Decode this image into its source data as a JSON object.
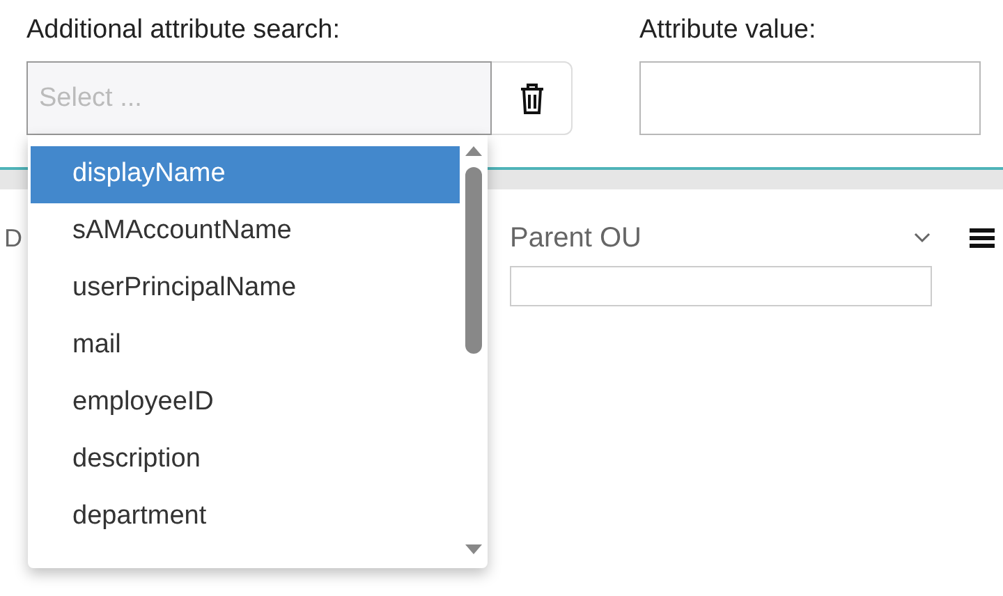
{
  "search_label": "Additional attribute search:",
  "search_field": {
    "placeholder": "Select ..."
  },
  "value_label": "Attribute value:",
  "dropdown": {
    "items": [
      {
        "label": "displayName",
        "selected": true
      },
      {
        "label": "sAMAccountName",
        "selected": false
      },
      {
        "label": "userPrincipalName",
        "selected": false
      },
      {
        "label": "mail",
        "selected": false
      },
      {
        "label": "employeeID",
        "selected": false
      },
      {
        "label": "description",
        "selected": false
      },
      {
        "label": "department",
        "selected": false
      }
    ]
  },
  "grid": {
    "columns": [
      {
        "header": "D"
      },
      {
        "header": "Parent OU"
      }
    ]
  }
}
